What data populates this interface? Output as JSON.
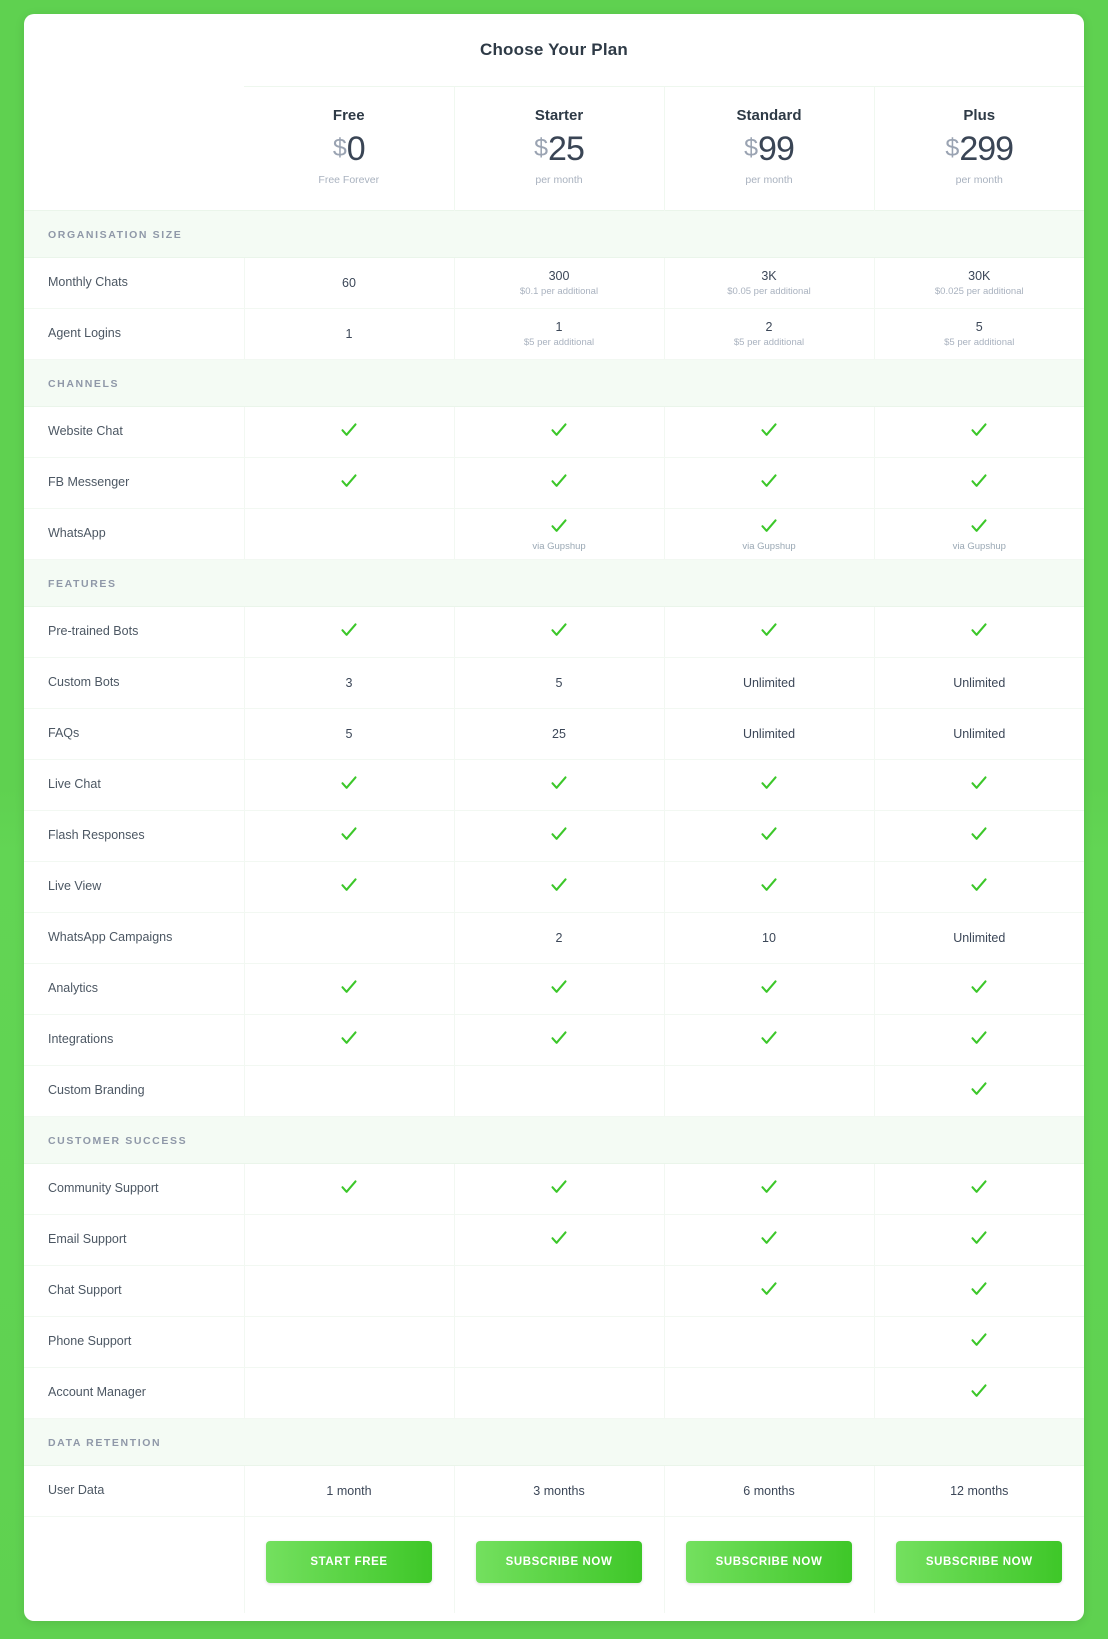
{
  "header": {
    "title": "Choose Your Plan"
  },
  "colors": {
    "page_background": "#5fd150",
    "check_green": "#3cc72a",
    "button_gradient_start": "#74e05f",
    "button_gradient_end": "#3ec728",
    "section_background": "#f4fbf4",
    "section_label": "#8f98a8"
  },
  "plans": [
    {
      "name": "Free",
      "currency": "$",
      "amount": "0",
      "period": "Free Forever",
      "cta": "START FREE"
    },
    {
      "name": "Starter",
      "currency": "$",
      "amount": "25",
      "period": "per month",
      "cta": "SUBSCRIBE NOW"
    },
    {
      "name": "Standard",
      "currency": "$",
      "amount": "99",
      "period": "per month",
      "cta": "SUBSCRIBE NOW"
    },
    {
      "name": "Plus",
      "currency": "$",
      "amount": "299",
      "period": "per month",
      "cta": "SUBSCRIBE NOW"
    }
  ],
  "sections": [
    {
      "label": "ORGANISATION SIZE",
      "rows": [
        {
          "name": "Monthly Chats",
          "cells": [
            {
              "type": "text",
              "value": "60"
            },
            {
              "type": "text",
              "value": "300",
              "sub": "$0.1 per additional"
            },
            {
              "type": "text",
              "value": "3K",
              "sub": "$0.05 per additional"
            },
            {
              "type": "text",
              "value": "30K",
              "sub": "$0.025 per additional"
            }
          ]
        },
        {
          "name": "Agent Logins",
          "cells": [
            {
              "type": "text",
              "value": "1"
            },
            {
              "type": "text",
              "value": "1",
              "sub": "$5 per additional"
            },
            {
              "type": "text",
              "value": "2",
              "sub": "$5 per additional"
            },
            {
              "type": "text",
              "value": "5",
              "sub": "$5 per additional"
            }
          ]
        }
      ]
    },
    {
      "label": "CHANNELS",
      "rows": [
        {
          "name": "Website Chat",
          "cells": [
            {
              "type": "check"
            },
            {
              "type": "check"
            },
            {
              "type": "check"
            },
            {
              "type": "check"
            }
          ]
        },
        {
          "name": "FB Messenger",
          "cells": [
            {
              "type": "check"
            },
            {
              "type": "check"
            },
            {
              "type": "check"
            },
            {
              "type": "check"
            }
          ]
        },
        {
          "name": "WhatsApp",
          "cells": [
            {
              "type": "empty"
            },
            {
              "type": "check",
              "sub": "via Gupshup"
            },
            {
              "type": "check",
              "sub": "via Gupshup"
            },
            {
              "type": "check",
              "sub": "via Gupshup"
            }
          ]
        }
      ]
    },
    {
      "label": "FEATURES",
      "rows": [
        {
          "name": "Pre-trained Bots",
          "cells": [
            {
              "type": "check"
            },
            {
              "type": "check"
            },
            {
              "type": "check"
            },
            {
              "type": "check"
            }
          ]
        },
        {
          "name": "Custom Bots",
          "cells": [
            {
              "type": "text",
              "value": "3"
            },
            {
              "type": "text",
              "value": "5"
            },
            {
              "type": "text",
              "value": "Unlimited"
            },
            {
              "type": "text",
              "value": "Unlimited"
            }
          ]
        },
        {
          "name": "FAQs",
          "cells": [
            {
              "type": "text",
              "value": "5"
            },
            {
              "type": "text",
              "value": "25"
            },
            {
              "type": "text",
              "value": "Unlimited"
            },
            {
              "type": "text",
              "value": "Unlimited"
            }
          ]
        },
        {
          "name": "Live Chat",
          "cells": [
            {
              "type": "check"
            },
            {
              "type": "check"
            },
            {
              "type": "check"
            },
            {
              "type": "check"
            }
          ]
        },
        {
          "name": "Flash Responses",
          "cells": [
            {
              "type": "check"
            },
            {
              "type": "check"
            },
            {
              "type": "check"
            },
            {
              "type": "check"
            }
          ]
        },
        {
          "name": "Live View",
          "cells": [
            {
              "type": "check"
            },
            {
              "type": "check"
            },
            {
              "type": "check"
            },
            {
              "type": "check"
            }
          ]
        },
        {
          "name": "WhatsApp Campaigns",
          "tall": true,
          "cells": [
            {
              "type": "empty"
            },
            {
              "type": "text",
              "value": "2"
            },
            {
              "type": "text",
              "value": "10"
            },
            {
              "type": "text",
              "value": "Unlimited"
            }
          ]
        },
        {
          "name": "Analytics",
          "cells": [
            {
              "type": "check"
            },
            {
              "type": "check"
            },
            {
              "type": "check"
            },
            {
              "type": "check"
            }
          ]
        },
        {
          "name": "Integrations",
          "cells": [
            {
              "type": "check"
            },
            {
              "type": "check"
            },
            {
              "type": "check"
            },
            {
              "type": "check"
            }
          ]
        },
        {
          "name": "Custom Branding",
          "cells": [
            {
              "type": "empty"
            },
            {
              "type": "empty"
            },
            {
              "type": "empty"
            },
            {
              "type": "check"
            }
          ]
        }
      ]
    },
    {
      "label": "CUSTOMER SUCCESS",
      "rows": [
        {
          "name": "Community Support",
          "cells": [
            {
              "type": "check"
            },
            {
              "type": "check"
            },
            {
              "type": "check"
            },
            {
              "type": "check"
            }
          ]
        },
        {
          "name": "Email Support",
          "cells": [
            {
              "type": "empty"
            },
            {
              "type": "check"
            },
            {
              "type": "check"
            },
            {
              "type": "check"
            }
          ]
        },
        {
          "name": "Chat Support",
          "cells": [
            {
              "type": "empty"
            },
            {
              "type": "empty"
            },
            {
              "type": "check"
            },
            {
              "type": "check"
            }
          ]
        },
        {
          "name": "Phone Support",
          "cells": [
            {
              "type": "empty"
            },
            {
              "type": "empty"
            },
            {
              "type": "empty"
            },
            {
              "type": "check"
            }
          ]
        },
        {
          "name": "Account Manager",
          "cells": [
            {
              "type": "empty"
            },
            {
              "type": "empty"
            },
            {
              "type": "empty"
            },
            {
              "type": "check"
            }
          ]
        }
      ]
    },
    {
      "label": "DATA RETENTION",
      "rows": [
        {
          "name": "User Data",
          "cells": [
            {
              "type": "text",
              "value": "1 month"
            },
            {
              "type": "text",
              "value": "3 months"
            },
            {
              "type": "text",
              "value": "6 months"
            },
            {
              "type": "text",
              "value": "12 months"
            }
          ]
        }
      ]
    }
  ]
}
